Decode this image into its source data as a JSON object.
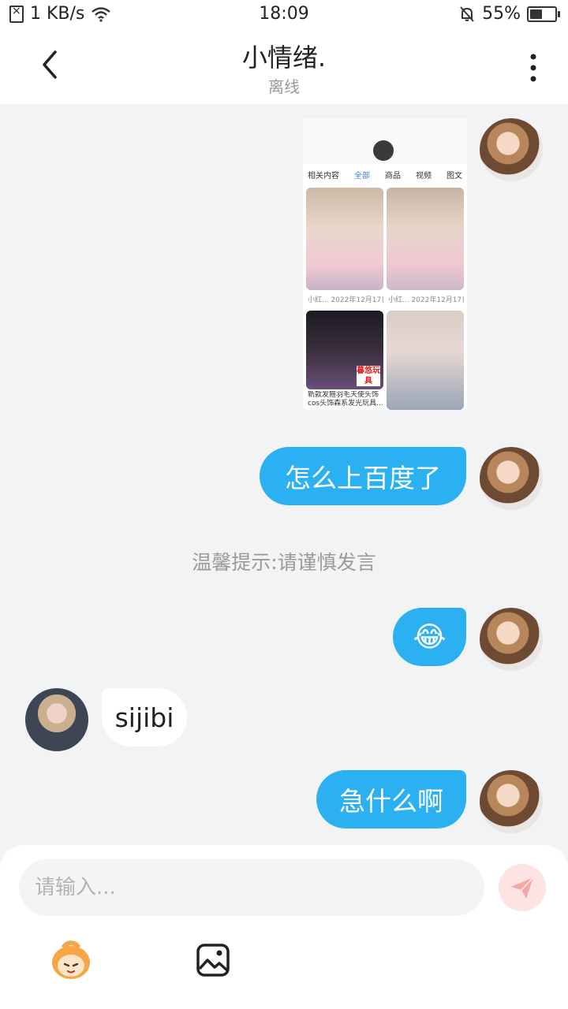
{
  "status_bar": {
    "network_speed": "1 KB/s",
    "time": "18:09",
    "battery": "55%",
    "battery_level": 0.55
  },
  "header": {
    "title": "小情绪.",
    "status": "离线"
  },
  "screenshot_preview": {
    "related_label": "相关内容",
    "tabs": [
      "全部",
      "商品",
      "视频",
      "图文"
    ],
    "captions": [
      "小红... 2022年12月17日",
      "小红... 2022年12月17日"
    ],
    "product_caption": "新款发箍羽毛天使头饰cos头饰森系发光玩具...",
    "badge": "暮悠玩具"
  },
  "messages": [
    {
      "sender": "me",
      "type": "image"
    },
    {
      "sender": "me",
      "type": "text",
      "text": "怎么上百度了"
    },
    {
      "sender": "system",
      "type": "notice",
      "text": "温馨提示:请谨慎发言"
    },
    {
      "sender": "me",
      "type": "emoji",
      "text": "😂"
    },
    {
      "sender": "other",
      "type": "text",
      "text": "sijibi"
    },
    {
      "sender": "me",
      "type": "text",
      "text": "急什么啊"
    }
  ],
  "composer": {
    "placeholder": "请输入...",
    "icons": [
      "send-icon",
      "emoji-icon",
      "image-icon"
    ]
  },
  "colors": {
    "my_bubble": "#2bb0f2",
    "other_bubble": "#ffffff",
    "background": "#f2f3f5",
    "send_button": "#fde4e2"
  }
}
